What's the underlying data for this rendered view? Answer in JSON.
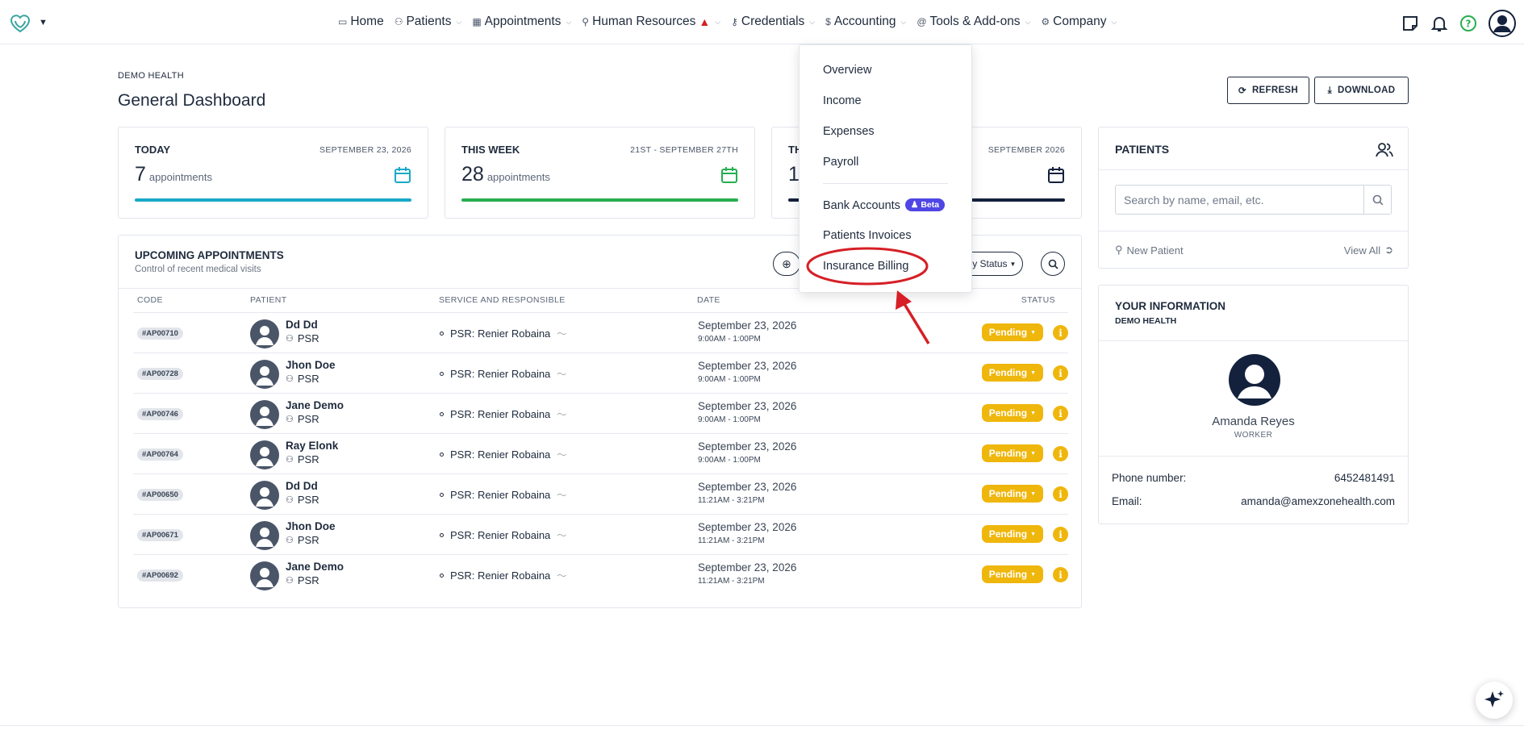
{
  "nav": {
    "items": [
      {
        "label": "Home",
        "icon": "monitor-icon"
      },
      {
        "label": "Patients",
        "icon": "users-icon"
      },
      {
        "label": "Appointments",
        "icon": "calendar-icon"
      },
      {
        "label": "Human Resources",
        "icon": "user-plus-icon"
      },
      {
        "label": "Credentials",
        "icon": "key-icon"
      },
      {
        "label": "Accounting",
        "icon": "dollar-icon"
      },
      {
        "label": "Tools & Add-ons",
        "icon": "at-icon"
      },
      {
        "label": "Company",
        "icon": "gear-icon"
      }
    ]
  },
  "header": {
    "brand": "DEMO HEALTH",
    "title": "General Dashboard",
    "refresh_label": "REFRESH",
    "download_label": "DOWNLOAD"
  },
  "stats": [
    {
      "label": "TODAY",
      "date": "SEPTEMBER 23, 2026",
      "value": "7",
      "unit": "appointments",
      "color": "#19a9c7"
    },
    {
      "label": "THIS WEEK",
      "date": "21ST - SEPTEMBER 27TH",
      "value": "28",
      "unit": "appointments",
      "color": "#27ae4f"
    },
    {
      "label": "TH",
      "date": "SEPTEMBER 2026",
      "value": "1",
      "unit": "",
      "color": "#14213d"
    }
  ],
  "appointments": {
    "title": "UPCOMING APPOINTMENTS",
    "subtitle": "Control of recent medical visits",
    "status_filter": "Any Status",
    "columns": [
      "CODE",
      "PATIENT",
      "SERVICE AND RESPONSIBLE",
      "DATE",
      "STATUS"
    ],
    "rows": [
      {
        "code": "#AP00710",
        "name": "Dd Dd",
        "role": "PSR",
        "service": "PSR: Renier Robaina",
        "date": "September 23, 2026",
        "time": "9:00AM - 1:00PM",
        "status": "Pending"
      },
      {
        "code": "#AP00728",
        "name": "Jhon Doe",
        "role": "PSR",
        "service": "PSR: Renier Robaina",
        "date": "September 23, 2026",
        "time": "9:00AM - 1:00PM",
        "status": "Pending"
      },
      {
        "code": "#AP00746",
        "name": "Jane Demo",
        "role": "PSR",
        "service": "PSR: Renier Robaina",
        "date": "September 23, 2026",
        "time": "9:00AM - 1:00PM",
        "status": "Pending"
      },
      {
        "code": "#AP00764",
        "name": "Ray Elonk",
        "role": "PSR",
        "service": "PSR: Renier Robaina",
        "date": "September 23, 2026",
        "time": "9:00AM - 1:00PM",
        "status": "Pending"
      },
      {
        "code": "#AP00650",
        "name": "Dd Dd",
        "role": "PSR",
        "service": "PSR: Renier Robaina",
        "date": "September 23, 2026",
        "time": "11:21AM - 3:21PM",
        "status": "Pending"
      },
      {
        "code": "#AP00671",
        "name": "Jhon Doe",
        "role": "PSR",
        "service": "PSR: Renier Robaina",
        "date": "September 23, 2026",
        "time": "11:21AM - 3:21PM",
        "status": "Pending"
      },
      {
        "code": "#AP00692",
        "name": "Jane Demo",
        "role": "PSR",
        "service": "PSR: Renier Robaina",
        "date": "September 23, 2026",
        "time": "11:21AM - 3:21PM",
        "status": "Pending"
      }
    ]
  },
  "accounting_menu": {
    "items": [
      "Overview",
      "Income",
      "Expenses",
      "Payroll",
      "Bank Accounts",
      "Patients Invoices",
      "Insurance Billing"
    ],
    "beta_label": "Beta"
  },
  "patients_panel": {
    "title": "PATIENTS",
    "search_placeholder": "Search by name, email, etc.",
    "new_label": "New Patient",
    "view_all_label": "View All"
  },
  "info_panel": {
    "title": "YOUR INFORMATION",
    "subtitle": "DEMO HEALTH",
    "name": "Amanda Reyes",
    "role": "WORKER",
    "phone_label": "Phone number:",
    "phone": "6452481491",
    "email_label": "Email:",
    "email": "amanda@amexzonehealth.com"
  },
  "colors": {
    "accent": "#14213d",
    "pending": "#efb60b",
    "beta": "#4f46e5",
    "highlight": "#d61f26"
  }
}
